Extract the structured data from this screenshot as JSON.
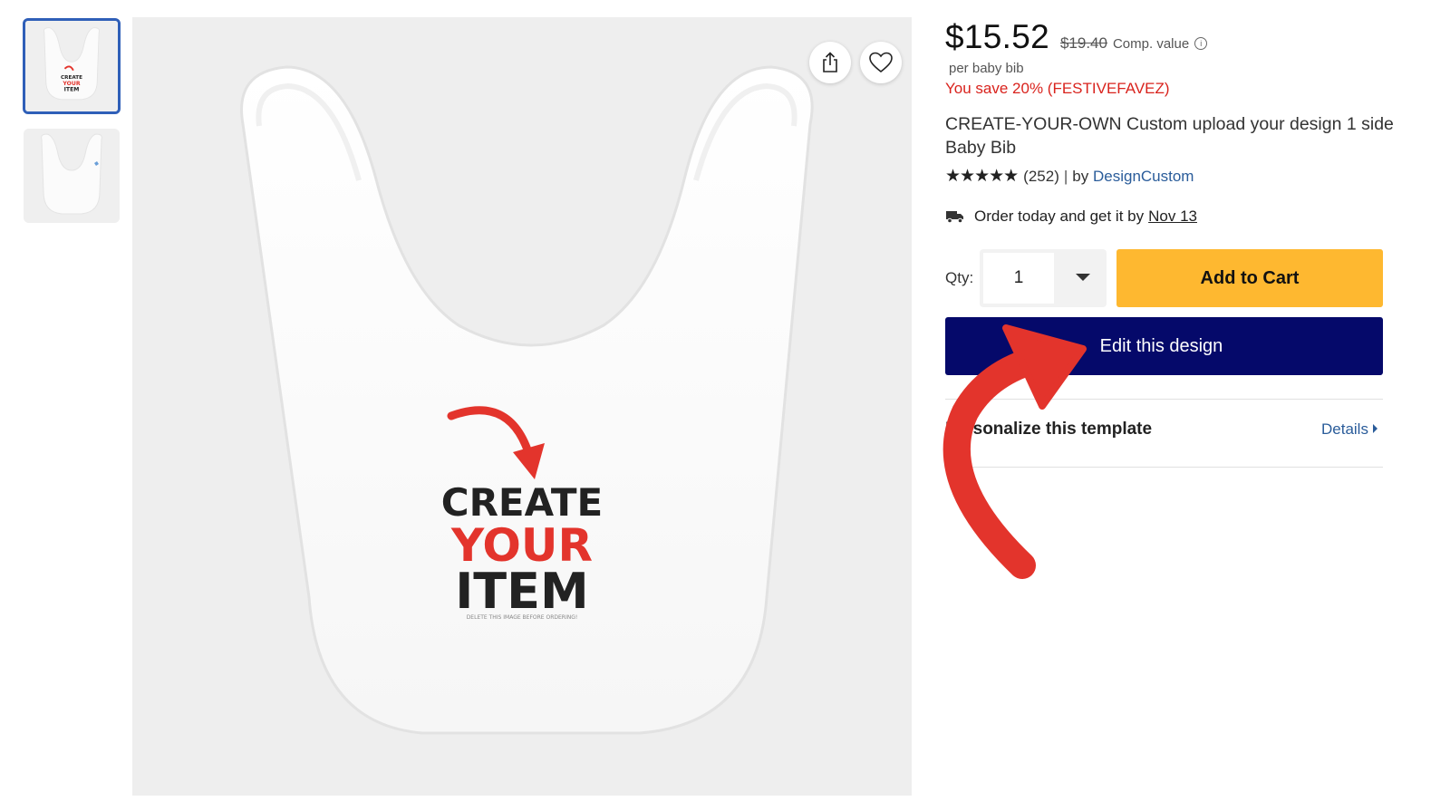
{
  "product": {
    "price": "$15.52",
    "original_price": "$19.40",
    "comp_label": "Comp. value",
    "unit": "per baby bib",
    "savings": "You save 20% (FESTIVEFAVEZ)",
    "title": "CREATE-YOUR-OWN Custom upload your design 1 side Baby Bib",
    "stars": "★★★★★",
    "rating_count": "(252)",
    "by_label": "by",
    "designer": "DesignCustom",
    "delivery_text": "Order today and get it by",
    "delivery_date": "Nov 13"
  },
  "purchase": {
    "qty_label": "Qty:",
    "qty_value": "1",
    "add_to_cart": "Add to Cart",
    "edit_design": "Edit this design"
  },
  "personalize": {
    "title": "Personalize this template",
    "details_link": "Details"
  },
  "artwork": {
    "line1": "CREATE",
    "line2": "YOUR",
    "line3": "ITEM",
    "fine_print": "DELETE THIS IMAGE BEFORE ORDERING!"
  },
  "colors": {
    "accent_red": "#e3342c",
    "cart_yellow": "#feb830",
    "edit_navy": "#05096a",
    "link_blue": "#2a5c9a",
    "selected_thumb_border": "#2f5fb8"
  },
  "icons": [
    "share-icon",
    "heart-icon",
    "info-icon",
    "truck-icon",
    "chevron-down-icon",
    "caret-right-icon"
  ]
}
